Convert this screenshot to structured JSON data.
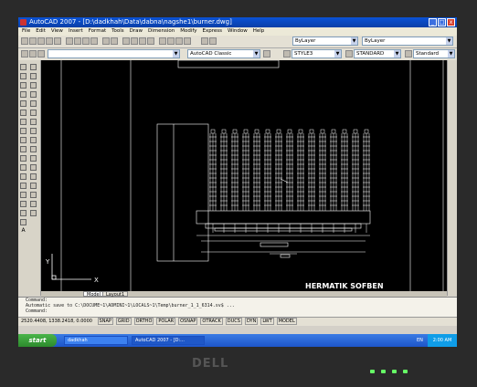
{
  "window": {
    "title": "AutoCAD 2007 - [D:\\dadkhah\\Data\\dabna\\nagshe1\\burner.dwg]",
    "buttons": {
      "minimize": "_",
      "maximize": "□",
      "close": "x"
    }
  },
  "menu": [
    "File",
    "Edit",
    "View",
    "Insert",
    "Format",
    "Tools",
    "Draw",
    "Dimension",
    "Modify",
    "Express",
    "Window",
    "Help"
  ],
  "toolbar": {
    "layer_value": "ByLayer",
    "linetype_value": "ByLayer",
    "workspace_value": "AutoCAD Classic",
    "text_style_value": "STYLE3",
    "dim_style_value": "STANDARD",
    "table_style_value": "Standard"
  },
  "drawing": {
    "label": "HERMATIK SOFBEN",
    "ucs_x": "X",
    "ucs_y": "Y",
    "colors": {
      "background": "#000000",
      "lines": "#ffffff"
    }
  },
  "tabs": {
    "model": "Model",
    "layout": "Layout1"
  },
  "command": {
    "line1": "Command:",
    "line2": "Automatic save to C:\\DOCUME~1\\ADMINI~1\\LOCALS~1\\Temp\\burner_1_1_6314.sv$ ...",
    "line3": "Command:"
  },
  "status": {
    "coords": "2520.4408, 1338.2418, 0.0000",
    "toggles": [
      "SNAP",
      "GRID",
      "ORTHO",
      "POLAR",
      "OSNAP",
      "OTRACK",
      "DUCS",
      "DYN",
      "LWT",
      "MODEL"
    ]
  },
  "taskbar": {
    "start": "start",
    "items": [
      "dadkhah",
      "AutoCAD 2007 - [D:..."
    ],
    "lang": "EN",
    "clock": "2:00 AM"
  },
  "bezel": {
    "brand": "DELL"
  }
}
